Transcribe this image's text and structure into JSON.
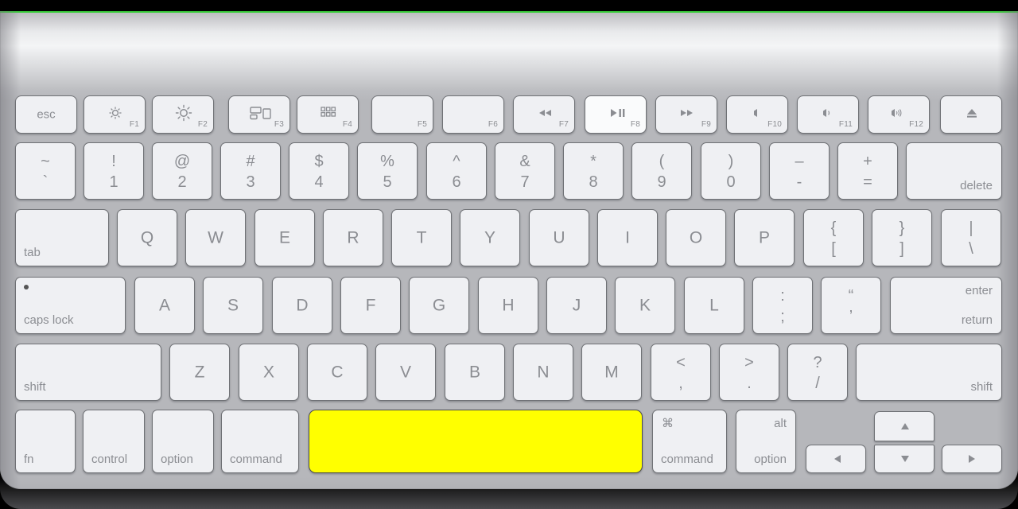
{
  "device": {
    "name": "apple-wireless-keyboard",
    "layout": "US ANSI",
    "body_color": "#b6b7bb",
    "key_color": "#eff0f3",
    "key_border_color": "#6f7175",
    "legend_color": "#8b8d92",
    "highlight_key": "space",
    "highlight_color": "#ffff00",
    "accent_line_color": "#24d024"
  },
  "rows": {
    "function": [
      {
        "id": "esc",
        "center": "esc"
      },
      {
        "id": "f1",
        "icon": "brightness-down-icon",
        "fn": "F1"
      },
      {
        "id": "f2",
        "icon": "brightness-up-icon",
        "fn": "F2"
      },
      {
        "id": "f3",
        "icon": "mission-control-icon",
        "fn": "F3"
      },
      {
        "id": "f4",
        "icon": "launchpad-icon",
        "fn": "F4"
      },
      {
        "id": "f5",
        "icon": "none",
        "fn": "F5"
      },
      {
        "id": "f6",
        "icon": "none",
        "fn": "F6"
      },
      {
        "id": "f7",
        "icon": "rewind-icon",
        "fn": "F7"
      },
      {
        "id": "f8",
        "icon": "play-pause-icon",
        "fn": "F8"
      },
      {
        "id": "f9",
        "icon": "fast-forward-icon",
        "fn": "F9"
      },
      {
        "id": "f10",
        "icon": "mute-icon",
        "fn": "F10"
      },
      {
        "id": "f11",
        "icon": "volume-down-icon",
        "fn": "F11"
      },
      {
        "id": "f12",
        "icon": "volume-up-icon",
        "fn": "F12"
      },
      {
        "id": "eject",
        "icon": "eject-icon"
      }
    ],
    "number": [
      {
        "id": "grave",
        "top": "~",
        "bottom": "`"
      },
      {
        "id": "1",
        "top": "!",
        "bottom": "1"
      },
      {
        "id": "2",
        "top": "@",
        "bottom": "2"
      },
      {
        "id": "3",
        "top": "#",
        "bottom": "3"
      },
      {
        "id": "4",
        "top": "$",
        "bottom": "4"
      },
      {
        "id": "5",
        "top": "%",
        "bottom": "5"
      },
      {
        "id": "6",
        "top": "^",
        "bottom": "6"
      },
      {
        "id": "7",
        "top": "&",
        "bottom": "7"
      },
      {
        "id": "8",
        "top": "*",
        "bottom": "8"
      },
      {
        "id": "9",
        "top": "(",
        "bottom": "9"
      },
      {
        "id": "0",
        "top": ")",
        "bottom": "0"
      },
      {
        "id": "minus",
        "top": "–",
        "bottom": "-"
      },
      {
        "id": "equal",
        "top": "+",
        "bottom": "="
      },
      {
        "id": "delete",
        "label": "delete"
      }
    ],
    "top_alpha": [
      {
        "id": "tab",
        "label": "tab"
      },
      {
        "id": "q",
        "center": "Q"
      },
      {
        "id": "w",
        "center": "W"
      },
      {
        "id": "e",
        "center": "E"
      },
      {
        "id": "r",
        "center": "R"
      },
      {
        "id": "t",
        "center": "T"
      },
      {
        "id": "y",
        "center": "Y"
      },
      {
        "id": "u",
        "center": "U"
      },
      {
        "id": "i",
        "center": "I"
      },
      {
        "id": "o",
        "center": "O"
      },
      {
        "id": "p",
        "center": "P"
      },
      {
        "id": "lbracket",
        "top": "{",
        "bottom": "["
      },
      {
        "id": "rbracket",
        "top": "}",
        "bottom": "]"
      },
      {
        "id": "backslash",
        "top": "|",
        "bottom": "\\"
      }
    ],
    "home": [
      {
        "id": "capslock",
        "label": "caps lock",
        "led": true
      },
      {
        "id": "a",
        "center": "A"
      },
      {
        "id": "s",
        "center": "S"
      },
      {
        "id": "d",
        "center": "D"
      },
      {
        "id": "f",
        "center": "F"
      },
      {
        "id": "g",
        "center": "G"
      },
      {
        "id": "h",
        "center": "H"
      },
      {
        "id": "j",
        "center": "J"
      },
      {
        "id": "k",
        "center": "K"
      },
      {
        "id": "l",
        "center": "L"
      },
      {
        "id": "semicolon",
        "top": ":",
        "bottom": ";"
      },
      {
        "id": "quote",
        "top": "“",
        "bottom": "’"
      },
      {
        "id": "return",
        "top_label": "enter",
        "bottom_label": "return"
      }
    ],
    "shift": [
      {
        "id": "lshift",
        "label": "shift"
      },
      {
        "id": "z",
        "center": "Z"
      },
      {
        "id": "x",
        "center": "X"
      },
      {
        "id": "c",
        "center": "C"
      },
      {
        "id": "v",
        "center": "V"
      },
      {
        "id": "b",
        "center": "B"
      },
      {
        "id": "n",
        "center": "N"
      },
      {
        "id": "m",
        "center": "M"
      },
      {
        "id": "comma",
        "top": "<",
        "bottom": ","
      },
      {
        "id": "period",
        "top": ">",
        "bottom": "."
      },
      {
        "id": "slash",
        "top": "?",
        "bottom": "/"
      },
      {
        "id": "rshift",
        "label": "shift"
      }
    ],
    "bottom": [
      {
        "id": "fn",
        "label": "fn"
      },
      {
        "id": "lcontrol",
        "label": "control"
      },
      {
        "id": "loption",
        "label": "option"
      },
      {
        "id": "lcommand",
        "label": "command"
      },
      {
        "id": "space",
        "label": ""
      },
      {
        "id": "rcommand",
        "top_label": "⌘",
        "bottom_label": "command"
      },
      {
        "id": "roption",
        "top_label": "alt",
        "bottom_label": "option"
      },
      {
        "id": "arrow-left",
        "icon": "arrow-left-icon"
      },
      {
        "id": "arrow-up",
        "icon": "arrow-up-icon"
      },
      {
        "id": "arrow-down",
        "icon": "arrow-down-icon"
      },
      {
        "id": "arrow-right",
        "icon": "arrow-right-icon"
      }
    ]
  }
}
